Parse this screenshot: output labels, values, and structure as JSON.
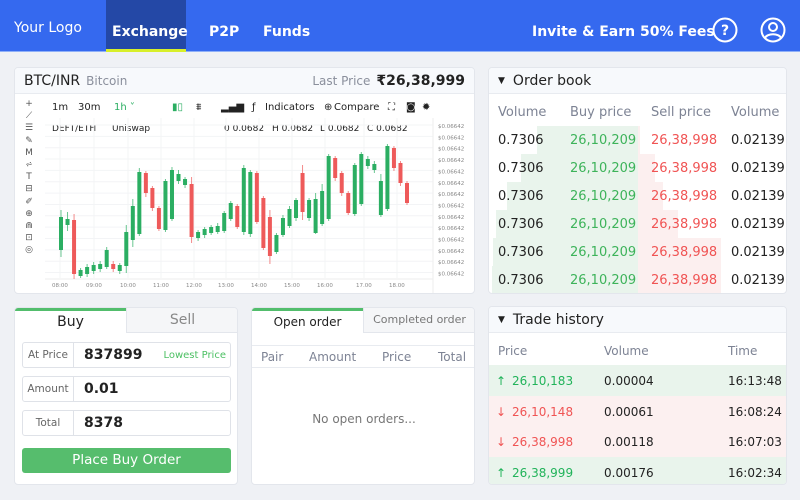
{
  "header": {
    "logo": "Your Logo",
    "tabs": [
      "Exchange",
      "P2P",
      "Funds"
    ],
    "invite": "Invite & Earn 50% Fees",
    "accent": "#3569ef"
  },
  "market": {
    "pair": "BTC/INR",
    "name": "Bitcoin",
    "last_price_label": "Last Price",
    "last_price": "₹26,38,999"
  },
  "chart_toolbar": {
    "intervals": [
      "1m",
      "30m",
      "1h"
    ],
    "indicators": "Indicators",
    "compare": "Compare",
    "symbol": "DEFT/ETH",
    "exchange": "Uniswap",
    "ohlc": [
      "0 0.0682",
      "H 0.0682",
      "L 0.0682",
      "C 0.0682"
    ]
  },
  "chart_data": {
    "type": "candlestick",
    "x_ticks": [
      "08:00",
      "09:00",
      "10:00",
      "11:00",
      "12:00",
      "13:00",
      "14:00",
      "15:00",
      "16:00",
      "17.00",
      "18.00"
    ],
    "y_ticks": [
      "$0.06642",
      "$0.06642",
      "$0.06642",
      "$0.06642",
      "$0.06642",
      "$0.06642",
      "$0.06642",
      "$0.06642",
      "$0.06642",
      "$0.06642",
      "$0.06642",
      "$0.06642",
      "$0.06642",
      "$0.06642"
    ],
    "ylim": [
      0,
      140
    ],
    "up_color": "#2bae62",
    "down_color": "#ee5a5a",
    "ohlc": [
      [
        31,
        64,
        71,
        24
      ],
      [
        56,
        62,
        69,
        50
      ],
      [
        61,
        7,
        67,
        2
      ],
      [
        5,
        11,
        13,
        3
      ],
      [
        7,
        14,
        17,
        4
      ],
      [
        10,
        16,
        19,
        7
      ],
      [
        12,
        17,
        20,
        9
      ],
      [
        14,
        31,
        34,
        12
      ],
      [
        17,
        12,
        20,
        9
      ],
      [
        10,
        16,
        18,
        7
      ],
      [
        15,
        49,
        56,
        8
      ],
      [
        41,
        75,
        82,
        34
      ],
      [
        47,
        109,
        113,
        45
      ],
      [
        108,
        88,
        110,
        84
      ],
      [
        93,
        73,
        95,
        70
      ],
      [
        73,
        52,
        75,
        50
      ],
      [
        51,
        100,
        102,
        49
      ],
      [
        62,
        111,
        114,
        60
      ],
      [
        100,
        107,
        111,
        97
      ],
      [
        96,
        102,
        104,
        93
      ],
      [
        97,
        44,
        104,
        38
      ],
      [
        43,
        49,
        51,
        40
      ],
      [
        46,
        52,
        54,
        43
      ],
      [
        48,
        54,
        56,
        46
      ],
      [
        49,
        55,
        58,
        47
      ],
      [
        50,
        68,
        70,
        48
      ],
      [
        62,
        78,
        80,
        60
      ],
      [
        75,
        54,
        77,
        52
      ],
      [
        49,
        113,
        116,
        46
      ],
      [
        47,
        109,
        111,
        44
      ],
      [
        108,
        59,
        110,
        57
      ],
      [
        83,
        33,
        85,
        31
      ],
      [
        64,
        25,
        71,
        17
      ],
      [
        29,
        46,
        48,
        27
      ],
      [
        46,
        63,
        66,
        44
      ],
      [
        55,
        72,
        75,
        53
      ],
      [
        63,
        81,
        83,
        60
      ],
      [
        108,
        69,
        116,
        61
      ],
      [
        63,
        81,
        83,
        60
      ],
      [
        48,
        82,
        88,
        47
      ],
      [
        57,
        90,
        97,
        55
      ],
      [
        62,
        125,
        127,
        60
      ],
      [
        123,
        103,
        125,
        100
      ],
      [
        108,
        88,
        110,
        85
      ],
      [
        88,
        68,
        90,
        66
      ],
      [
        67,
        116,
        118,
        65
      ],
      [
        77,
        127,
        129,
        75
      ],
      [
        115,
        122,
        125,
        112
      ],
      [
        111,
        117,
        120,
        108
      ],
      [
        66,
        100,
        107,
        64
      ],
      [
        72,
        135,
        137,
        70
      ],
      [
        133,
        113,
        135,
        110
      ],
      [
        118,
        98,
        120,
        95
      ],
      [
        98,
        78,
        100,
        76
      ]
    ]
  },
  "order_book": {
    "title": "Order book",
    "columns": [
      "Volume",
      "Buy price",
      "Sell price",
      "Volume"
    ],
    "rows": [
      {
        "bv": "0.7306",
        "bp": "26,10,209",
        "sp": "26,38,998",
        "sv": "0.02139",
        "bdepth": 0.69,
        "sdepth": 0.02
      },
      {
        "bv": "0.7306",
        "bp": "26,10,209",
        "sp": "26,38,998",
        "sv": "0.02139",
        "bdepth": 0.8,
        "sdepth": 0.21
      },
      {
        "bv": "0.7306",
        "bp": "26,10,209",
        "sp": "26,38,998",
        "sv": "0.02139",
        "bdepth": 0.9,
        "sdepth": 0.3
      },
      {
        "bv": "0.7306",
        "bp": "26,10,209",
        "sp": "26,38,998",
        "sv": "0.02139",
        "bdepth": 0.97,
        "sdepth": 0.48
      },
      {
        "bv": "0.7306",
        "bp": "26,10,209",
        "sp": "26,38,998",
        "sv": "0.02139",
        "bdepth": 0.99,
        "sdepth": 1.0
      },
      {
        "bv": "0.7306",
        "bp": "26,10,209",
        "sp": "26,38,998",
        "sv": "0.02139",
        "bdepth": 1.0,
        "sdepth": 1.0
      }
    ]
  },
  "order_form": {
    "tabs": [
      "Buy",
      "Sell"
    ],
    "at_price_label": "At Price",
    "at_price": "837899",
    "lowest_price": "Lowest Price",
    "amount_label": "Amount",
    "amount": "0.01",
    "total_label": "Total",
    "total": "8378",
    "submit": "Place Buy Order"
  },
  "orders": {
    "tabs": [
      "Open order",
      "Completed order"
    ],
    "columns": [
      "Pair",
      "Amount",
      "Price",
      "Total"
    ],
    "empty": "No open orders..."
  },
  "trade_history": {
    "title": "Trade history",
    "columns": [
      "Price",
      "Volume",
      "Time"
    ],
    "rows": [
      {
        "dir": "up",
        "arrow": "↑",
        "price": "26,10,183",
        "volume": "0.00004",
        "time": "16:13:48"
      },
      {
        "dir": "down",
        "arrow": "↓",
        "price": "26,10,148",
        "volume": "0.00061",
        "time": "16:08:24"
      },
      {
        "dir": "down",
        "arrow": "↓",
        "price": "26,38,998",
        "volume": "0.00118",
        "time": "16:07:03"
      },
      {
        "dir": "up",
        "arrow": "↑",
        "price": "26,38,999",
        "volume": "0.00176",
        "time": "16:02:34"
      }
    ]
  }
}
